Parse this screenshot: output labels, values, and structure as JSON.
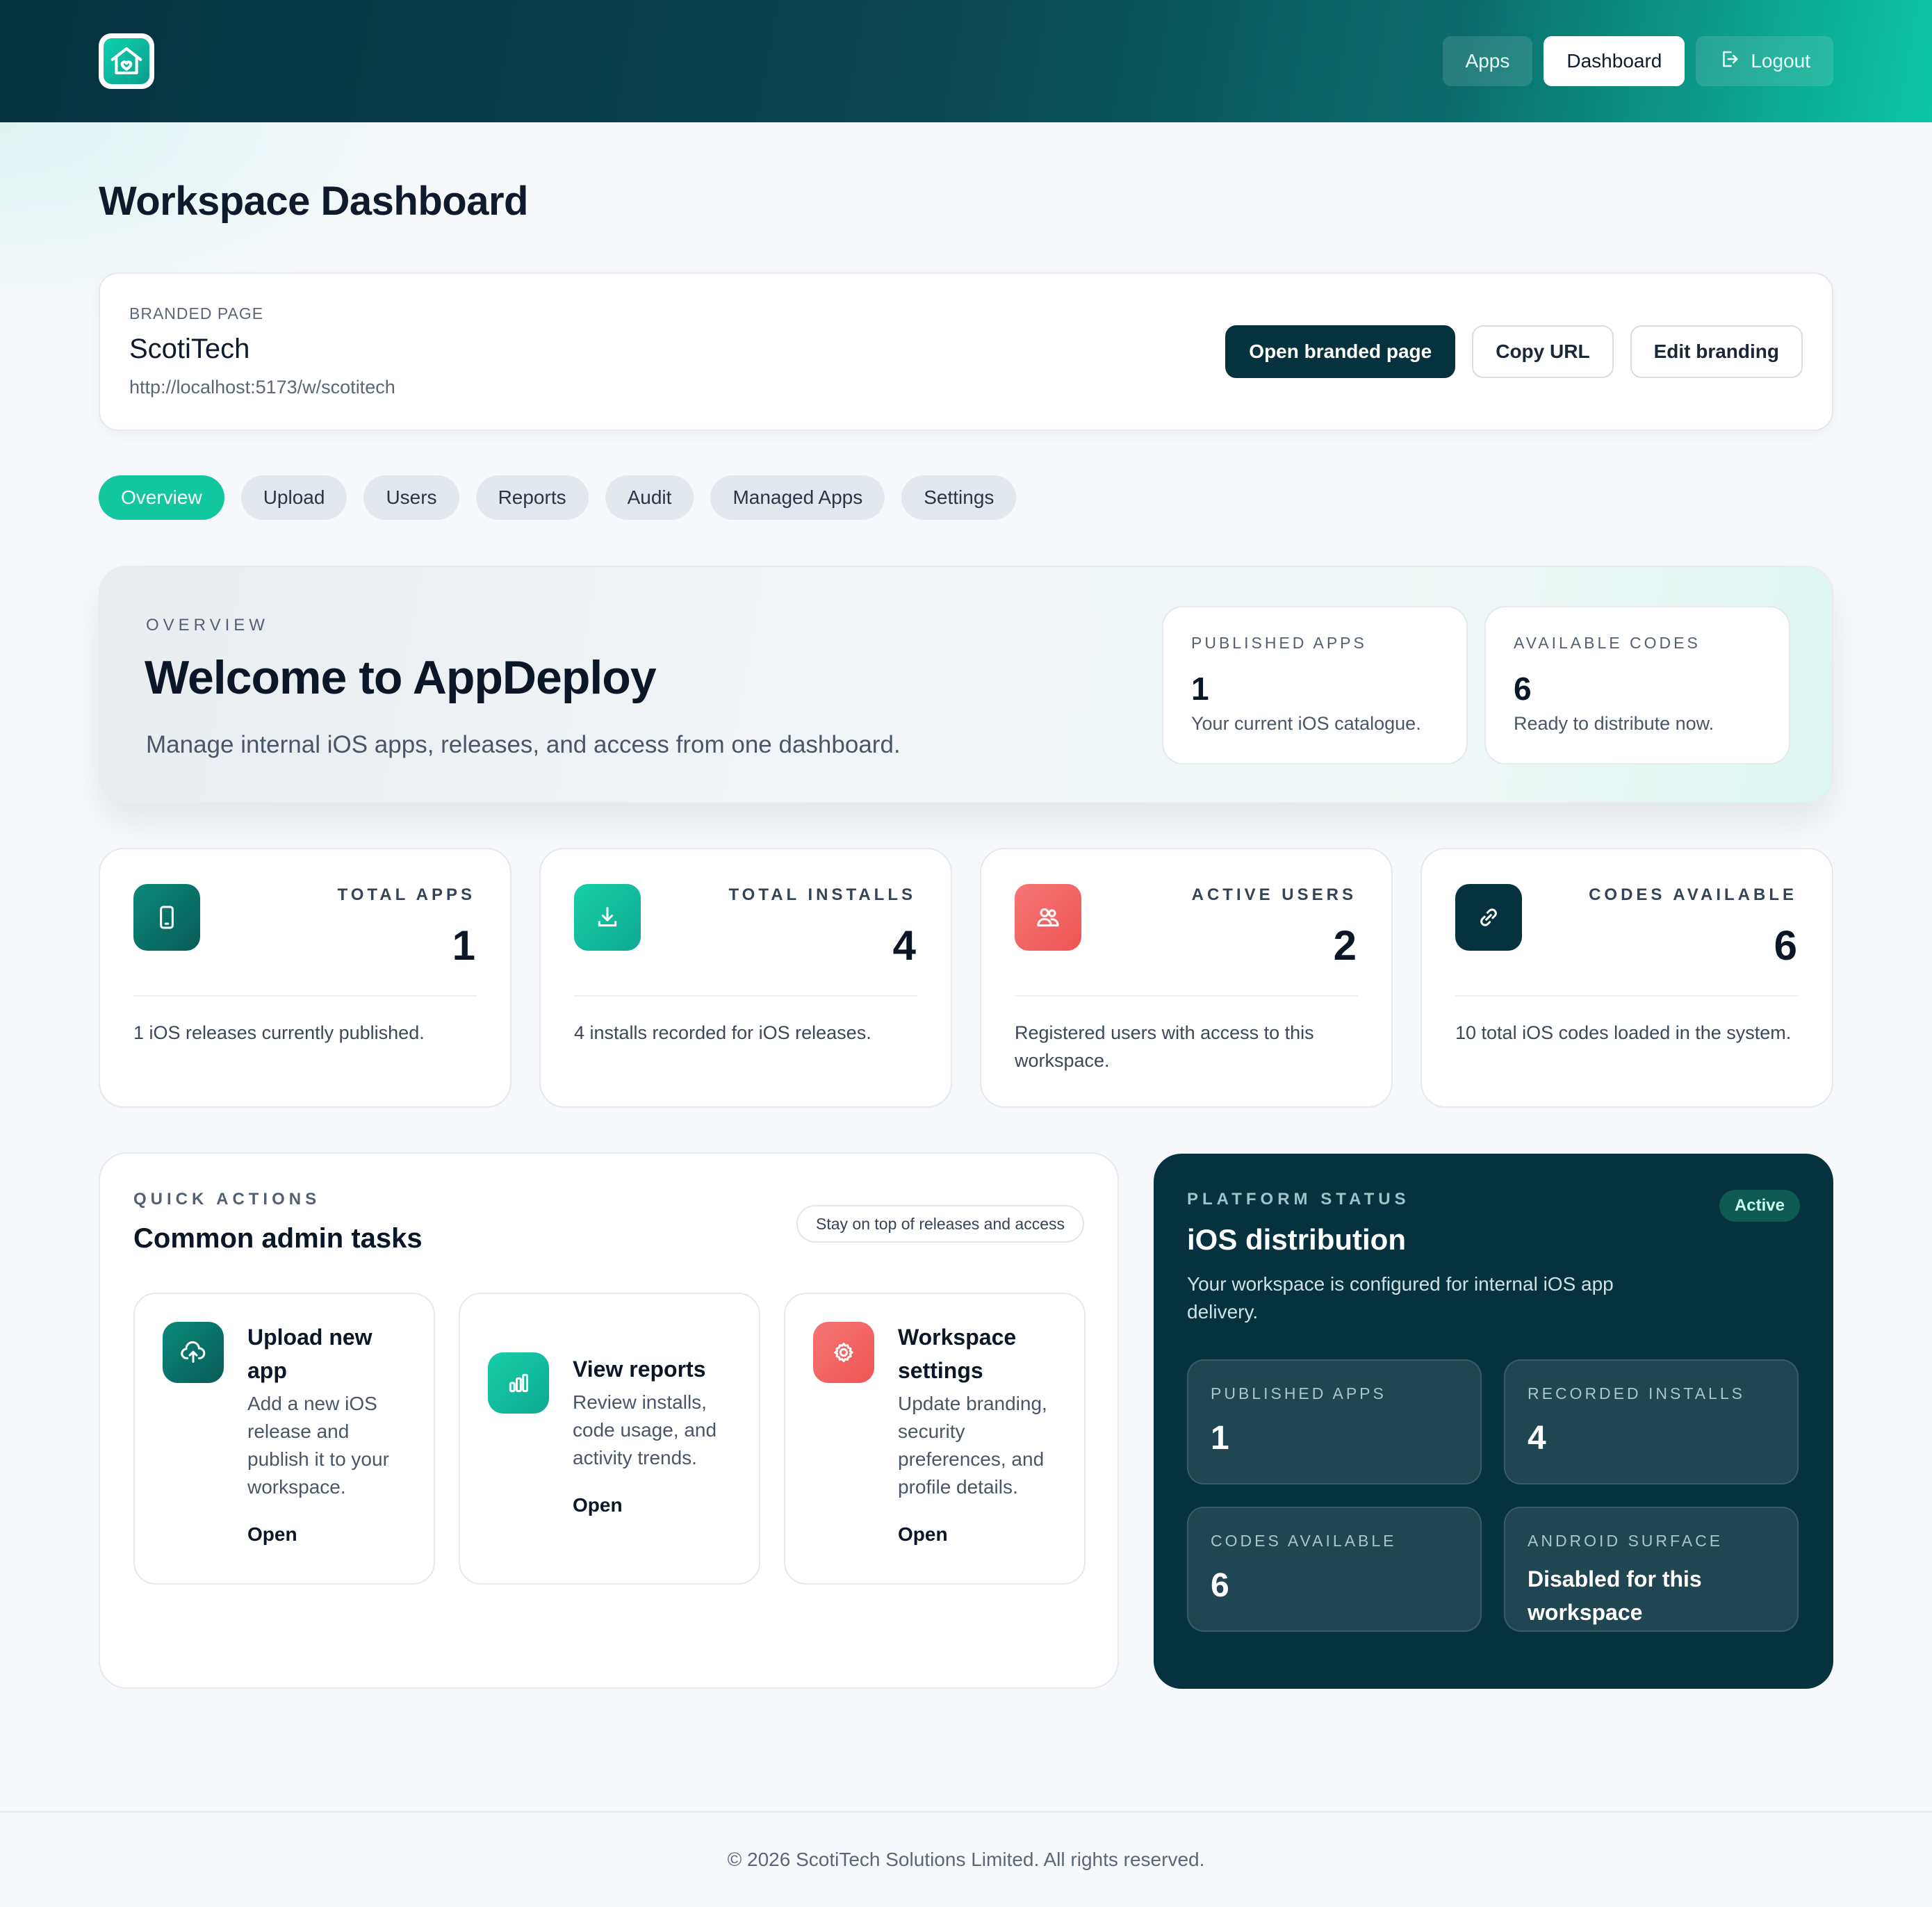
{
  "header": {
    "logo_icon": "home-heart-icon",
    "nav": [
      {
        "label": "Apps",
        "active": false
      },
      {
        "label": "Dashboard",
        "active": true
      },
      {
        "label": "Logout",
        "icon": "logout-icon",
        "active": false
      }
    ]
  },
  "page": {
    "title": "Workspace Dashboard"
  },
  "branded": {
    "eyebrow": "BRANDED PAGE",
    "name": "ScotiTech",
    "url": "http://localhost:5173/w/scotitech",
    "actions": {
      "open": "Open branded page",
      "copy": "Copy URL",
      "edit": "Edit branding"
    }
  },
  "tabs": [
    {
      "label": "Overview",
      "active": true
    },
    {
      "label": "Upload",
      "active": false
    },
    {
      "label": "Users",
      "active": false
    },
    {
      "label": "Reports",
      "active": false
    },
    {
      "label": "Audit",
      "active": false
    },
    {
      "label": "Managed Apps",
      "active": false
    },
    {
      "label": "Settings",
      "active": false
    }
  ],
  "hero": {
    "eyebrow": "OVERVIEW",
    "title": "Welcome to AppDeploy",
    "subtitle": "Manage internal iOS apps, releases, and access from one dashboard.",
    "mini": [
      {
        "label": "PUBLISHED APPS",
        "value": "1",
        "desc": "Your current iOS catalogue."
      },
      {
        "label": "AVAILABLE CODES",
        "value": "6",
        "desc": "Ready to distribute now."
      }
    ]
  },
  "stats": [
    {
      "label": "TOTAL APPS",
      "value": "1",
      "desc": "1 iOS releases currently published.",
      "icon": "phone-icon",
      "color": "#0a7a6c"
    },
    {
      "label": "TOTAL INSTALLS",
      "value": "4",
      "desc": "4 installs recorded for iOS releases.",
      "icon": "download-icon",
      "color": "#12b99a"
    },
    {
      "label": "ACTIVE USERS",
      "value": "2",
      "desc": "Registered users with access to this workspace.",
      "icon": "users-icon",
      "color": "#f06565"
    },
    {
      "label": "CODES AVAILABLE",
      "value": "6",
      "desc": "10 total iOS codes loaded in the system.",
      "icon": "link-icon",
      "color": "#06313f"
    }
  ],
  "quick_actions": {
    "eyebrow": "QUICK ACTIONS",
    "title": "Common admin tasks",
    "pill": "Stay on top of releases and access",
    "items": [
      {
        "title": "Upload new app",
        "desc": "Add a new iOS release and publish it to your workspace.",
        "open": "Open",
        "icon": "cloud-upload-icon",
        "color": "#0a7a6c"
      },
      {
        "title": "View reports",
        "desc": "Review installs, code usage, and activity trends.",
        "open": "Open",
        "icon": "bar-chart-icon",
        "color": "#12b99a"
      },
      {
        "title": "Workspace settings",
        "desc": "Update branding, security preferences, and profile details.",
        "open": "Open",
        "icon": "gear-icon",
        "color": "#f06565"
      }
    ]
  },
  "platform": {
    "eyebrow": "PLATFORM STATUS",
    "title": "iOS distribution",
    "badge": "Active",
    "desc": "Your workspace is configured for internal iOS app delivery.",
    "tiles": [
      {
        "label": "PUBLISHED APPS",
        "value": "1"
      },
      {
        "label": "RECORDED INSTALLS",
        "value": "4"
      },
      {
        "label": "CODES AVAILABLE",
        "value": "6"
      },
      {
        "label": "ANDROID SURFACE",
        "value": "Disabled for this workspace"
      }
    ]
  },
  "footer": {
    "text": "© 2026 ScotiTech Solutions Limited. All rights reserved."
  }
}
